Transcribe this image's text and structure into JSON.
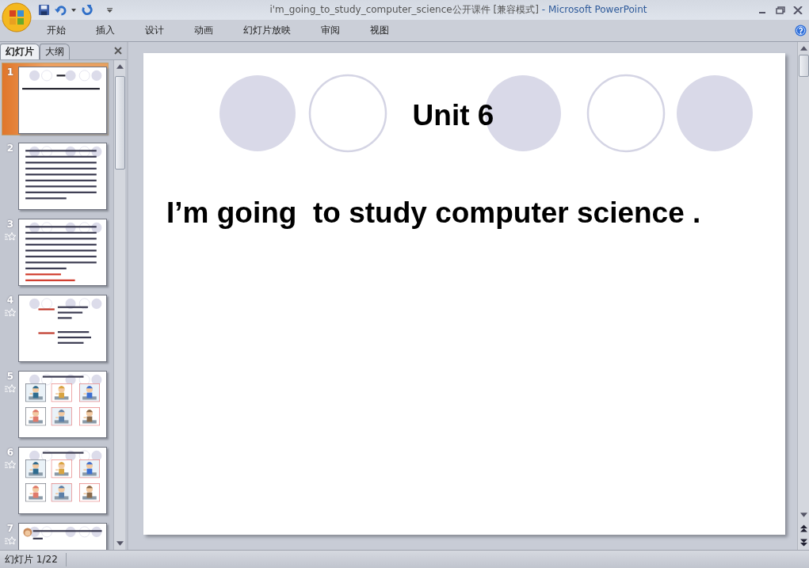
{
  "window": {
    "title": "i'm_going_to_study_computer_science公开课件 [兼容模式]",
    "app_name": "- Microsoft PowerPoint"
  },
  "ribbon_tabs": [
    "开始",
    "插入",
    "设计",
    "动画",
    "幻灯片放映",
    "审阅",
    "视图"
  ],
  "pane_tabs": [
    {
      "label": "幻灯片",
      "selected": true
    },
    {
      "label": "大纲",
      "selected": false
    }
  ],
  "thumbnails": [
    {
      "number": "1",
      "selected": true,
      "animation": false,
      "kind": "title"
    },
    {
      "number": "2",
      "selected": false,
      "animation": false,
      "kind": "text"
    },
    {
      "number": "3",
      "selected": false,
      "animation": true,
      "kind": "text-red"
    },
    {
      "number": "4",
      "selected": false,
      "animation": true,
      "kind": "two-column"
    },
    {
      "number": "5",
      "selected": false,
      "animation": true,
      "kind": "pictures"
    },
    {
      "number": "6",
      "selected": false,
      "animation": true,
      "kind": "pictures"
    },
    {
      "number": "7",
      "selected": false,
      "animation": true,
      "kind": "partial"
    }
  ],
  "slide": {
    "circles": [
      {
        "filled": true
      },
      {
        "filled": false
      },
      {
        "filled": true
      },
      {
        "filled": false
      },
      {
        "filled": true
      }
    ],
    "title": "Unit 6",
    "body": "I’m going  to study computer science ."
  },
  "status_bar": {
    "slide_counter": "幻灯片 1/22"
  }
}
